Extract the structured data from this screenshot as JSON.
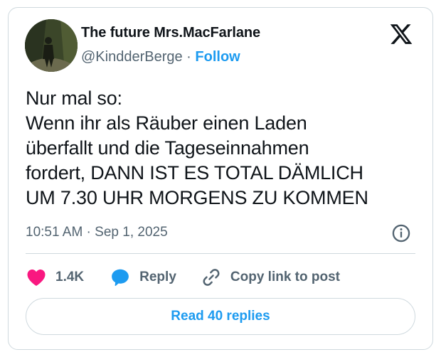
{
  "author": {
    "display_name": "The future Mrs.MacFarlane",
    "handle": "@KindderBerge",
    "separator": "·",
    "follow_label": "Follow"
  },
  "tweet": {
    "lines": [
      "Nur mal so:",
      "Wenn ihr als Räuber einen Laden",
      "überfallt und die Tageseinnahmen",
      "fordert, DANN IST ES TOTAL DÄMLICH",
      "UM 7.30 UHR MORGENS ZU KOMMEN"
    ],
    "timestamp": "10:51 AM · Sep 1, 2025"
  },
  "actions": {
    "like_count": "1.4K",
    "reply_label": "Reply",
    "copy_link_label": "Copy link to post"
  },
  "read_replies_label": "Read 40 replies",
  "icons": {
    "logo": "x-logo-icon",
    "info": "info-icon",
    "like": "heart-icon",
    "reply": "speech-bubble-icon",
    "copy": "link-icon"
  },
  "colors": {
    "accent": "#1d9bf0",
    "like": "#f91880",
    "text": "#0f1419",
    "secondary_text": "#536471",
    "border": "#cfd9de"
  }
}
